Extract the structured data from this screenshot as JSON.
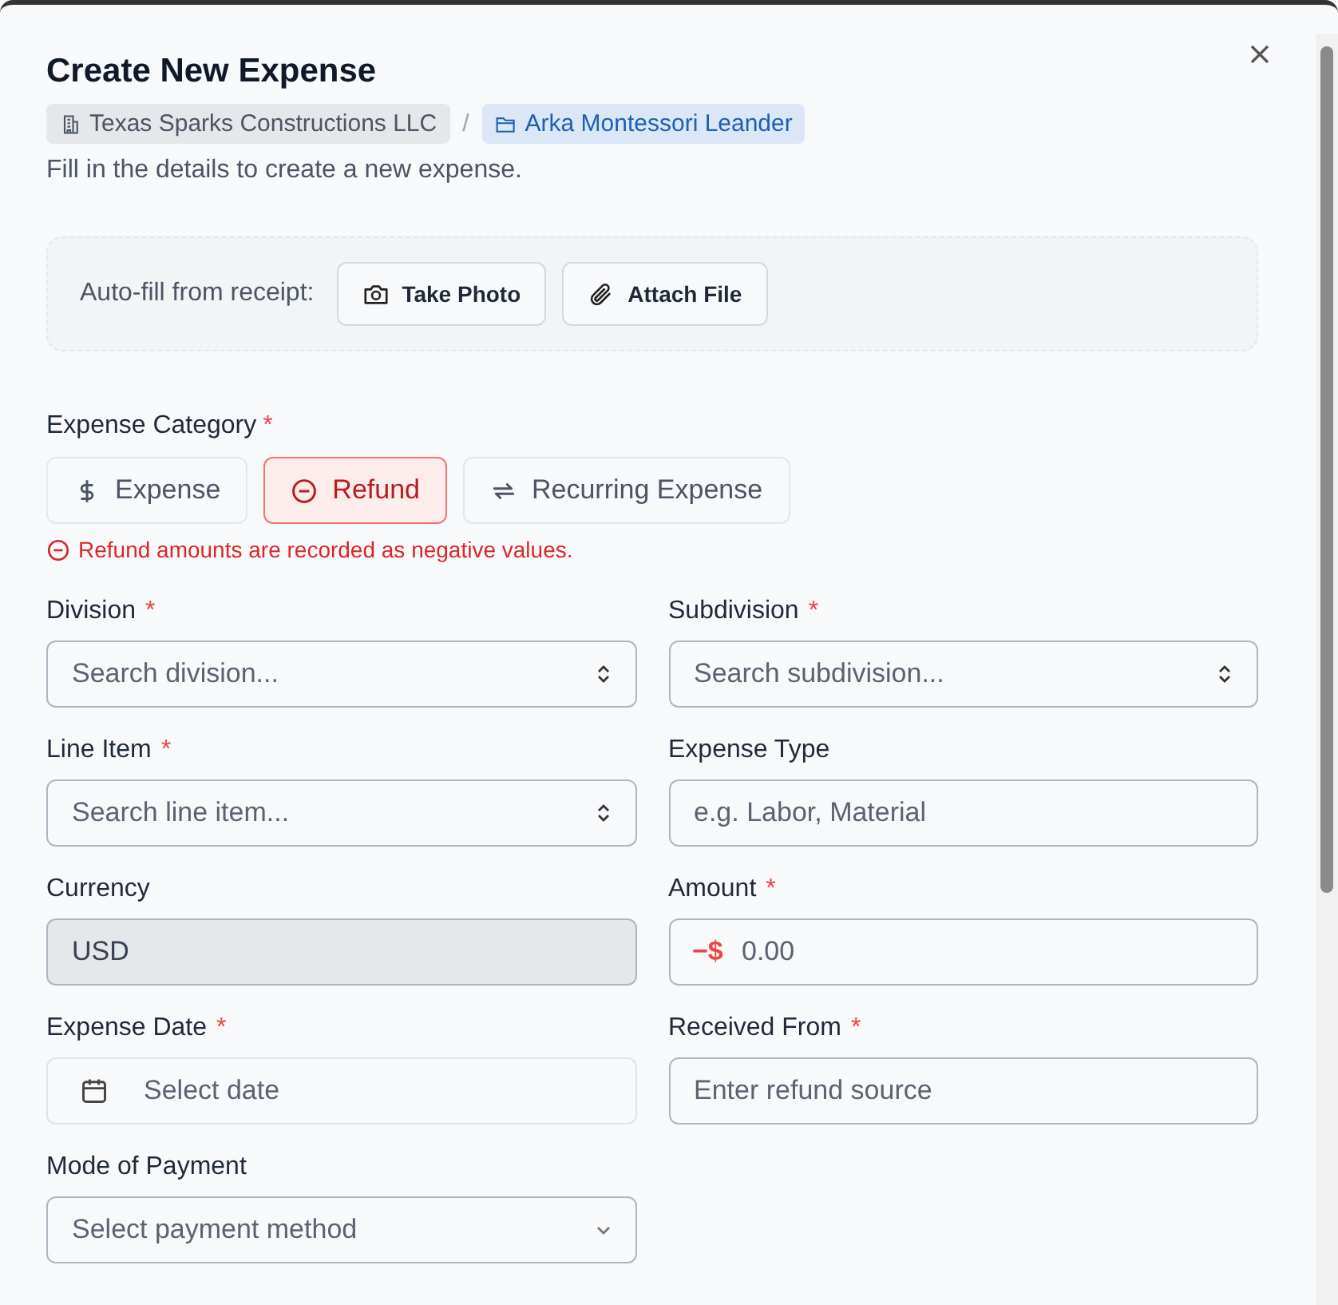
{
  "dialog": {
    "title": "Create New Expense",
    "breadcrumb": [
      {
        "label": "Texas Sparks Constructions LLC",
        "kind": "company"
      },
      {
        "label": "Arka Montessori Leander",
        "kind": "project"
      }
    ],
    "separator": "/",
    "description": "Fill in the details to create a new expense."
  },
  "autofill": {
    "label": "Auto-fill from receipt:",
    "buttons": [
      {
        "label": "Take Photo",
        "kind": "camera"
      },
      {
        "label": "Attach File",
        "kind": "attach"
      }
    ]
  },
  "category": {
    "label": "Expense Category",
    "required_mark": "*",
    "options": [
      {
        "label": "Expense",
        "kind": "dollar",
        "selected": false
      },
      {
        "label": "Refund",
        "kind": "minus",
        "selected": true
      },
      {
        "label": "Recurring Expense",
        "kind": "repeat",
        "selected": false
      }
    ],
    "note": "Refund amounts are recorded as negative values."
  },
  "fields": [
    {
      "label": "Division",
      "required_mark": "*",
      "kind": "combobox",
      "placeholder": "Search division..."
    },
    {
      "label": "Subdivision",
      "required_mark": "*",
      "kind": "combobox",
      "placeholder": "Search subdivision..."
    },
    {
      "label": "Line Item",
      "required_mark": "*",
      "kind": "combobox",
      "placeholder": "Search line item..."
    },
    {
      "label": "Expense Type",
      "kind": "text",
      "placeholder": "e.g. Labor, Material"
    },
    {
      "label": "Currency",
      "kind": "readonly",
      "value": "USD"
    },
    {
      "label": "Amount",
      "required_mark": "*",
      "kind": "amount",
      "prefix": "−$",
      "placeholder": "0.00"
    },
    {
      "label": "Expense Date",
      "required_mark": "*",
      "kind": "date",
      "placeholder": "Select date"
    },
    {
      "label": "Received From",
      "required_mark": "*",
      "kind": "text",
      "placeholder": "Enter refund source"
    },
    {
      "label": "Mode of Payment",
      "kind": "select",
      "placeholder": "Select payment method"
    }
  ]
}
